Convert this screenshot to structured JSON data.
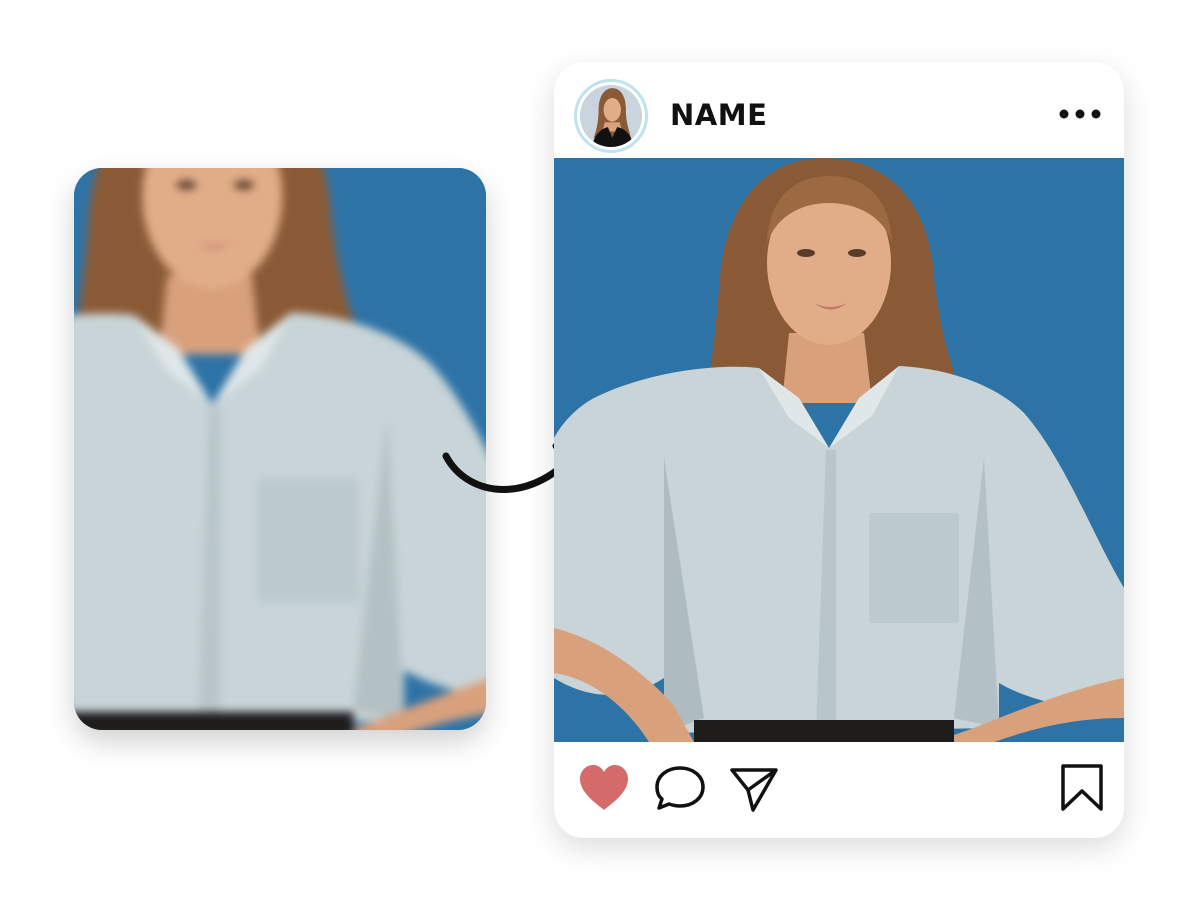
{
  "post": {
    "username": "NAME"
  },
  "icons": {
    "more": "more-horizontal-icon",
    "like": "heart-icon",
    "comment": "comment-icon",
    "share": "send-icon",
    "save": "bookmark-icon",
    "arrow": "curved-arrow-icon"
  },
  "colors": {
    "like_active": "#d46a6a",
    "sky": "#2f78ab",
    "shirt": "#c9d5d8",
    "avatar_ring": "#bfe2f0"
  }
}
